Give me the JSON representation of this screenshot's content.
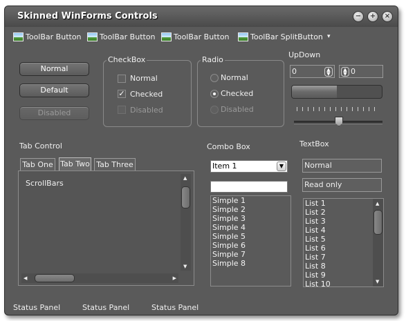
{
  "window": {
    "title": "Skinned WinForms Controls",
    "controls": [
      "minimize-icon",
      "maximize-icon",
      "close-icon"
    ]
  },
  "toolbar": {
    "items": [
      {
        "label": "ToolBar Button",
        "icon": "image-icon"
      },
      {
        "label": "ToolBar Button",
        "icon": "image-icon"
      },
      {
        "label": "ToolBar Button",
        "icon": "image-icon"
      },
      {
        "label": "ToolBar SplitButton",
        "icon": "image-icon"
      }
    ],
    "dropdown_glyph": "▾"
  },
  "buttons": {
    "normal": "Normal",
    "default": "Default",
    "disabled": "Disabled"
  },
  "checkbox": {
    "title": "CheckBox",
    "items": [
      {
        "label": "Normal",
        "checked": false,
        "enabled": true
      },
      {
        "label": "Checked",
        "checked": true,
        "enabled": true
      },
      {
        "label": "Disabled",
        "checked": false,
        "enabled": false
      }
    ]
  },
  "radio": {
    "title": "Radio",
    "items": [
      {
        "label": "Normal",
        "selected": false,
        "enabled": true
      },
      {
        "label": "Checked",
        "selected": true,
        "enabled": true
      },
      {
        "label": "Disabled",
        "selected": false,
        "enabled": false
      }
    ]
  },
  "updown": {
    "title": "UpDown",
    "value1": "0",
    "value2": "0",
    "progress": 0.5,
    "trackbar_fraction": 0.5
  },
  "tabcontrol": {
    "title": "Tab Control",
    "tabs": [
      "Tab One",
      "Tab Two",
      "Tab Three"
    ],
    "selected": 1,
    "content": "ScrollBars"
  },
  "combobox": {
    "title": "Combo Box",
    "dropdown_value": "Item 1",
    "simple_value": "",
    "simple_items": [
      "Simple 1",
      "Simple 2",
      "Simple 3",
      "Simple 4",
      "Simple 5",
      "Simple 6",
      "Simple 7",
      "Simple 8"
    ]
  },
  "textbox": {
    "title": "TextBox",
    "normal_value": "Normal",
    "readonly_value": "Read only",
    "list_items": [
      "List 1",
      "List 2",
      "List 3",
      "List 4",
      "List 5",
      "List 6",
      "List 7",
      "List 8",
      "List 9",
      "List 10"
    ]
  },
  "statusbar": {
    "panels": [
      "Status Panel",
      "Status Panel",
      "Status Panel"
    ]
  },
  "colors": {
    "window_bg": "#5a5a5a",
    "border": "#8c8c8c",
    "text": "#f0f0f0",
    "disabled_text": "#9a9a9a"
  }
}
